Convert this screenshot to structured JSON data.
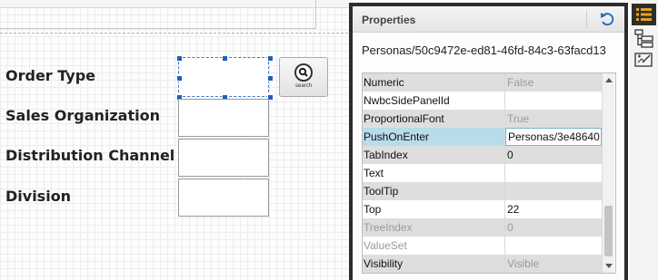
{
  "canvas": {
    "labels": [
      "Order Type",
      "Sales Organization",
      "Distribution Channel",
      "Division"
    ],
    "search_button": {
      "label": "search",
      "icon": "magnifier-icon"
    }
  },
  "properties_panel": {
    "title": "Properties",
    "undo_icon": "undo-icon",
    "path": "Personas/50c9472e-ed81-46fd-84c3-63facd13",
    "rows": [
      {
        "name": "Numeric",
        "value": "False",
        "style": "grey",
        "value_state": "disabled"
      },
      {
        "name": "NwbcSidePanelId",
        "value": "",
        "style": "white",
        "value_state": "normal"
      },
      {
        "name": "ProportionalFont",
        "value": "True",
        "style": "grey",
        "value_state": "disabled"
      },
      {
        "name": "PushOnEnter",
        "value": "Personas/3e48640",
        "style": "sel",
        "value_state": "normal"
      },
      {
        "name": "TabIndex",
        "value": "0",
        "style": "grey",
        "value_state": "normal"
      },
      {
        "name": "Text",
        "value": "",
        "style": "white",
        "value_state": "normal"
      },
      {
        "name": "ToolTip",
        "value": "",
        "style": "grey",
        "value_state": "normal"
      },
      {
        "name": "Top",
        "value": "22",
        "style": "white",
        "value_state": "normal"
      },
      {
        "name": "TreeIndex",
        "value": "0",
        "style": "grey",
        "value_state": "disabled",
        "name_state": "disabled"
      },
      {
        "name": "ValueSet",
        "value": "",
        "style": "white",
        "value_state": "normal",
        "name_state": "disabled"
      },
      {
        "name": "Visibility",
        "value": "Visible",
        "style": "grey",
        "value_state": "disabled"
      }
    ]
  },
  "toolbar": {
    "buttons": [
      "properties-list-icon",
      "tree-view-icon",
      "script-editor-icon"
    ]
  },
  "colors": {
    "accent": "#1f5fb8",
    "selected_row": "#b7dcea",
    "panel_border": "#2d2d2d",
    "toolbar_active_icon": "#e8a020"
  }
}
